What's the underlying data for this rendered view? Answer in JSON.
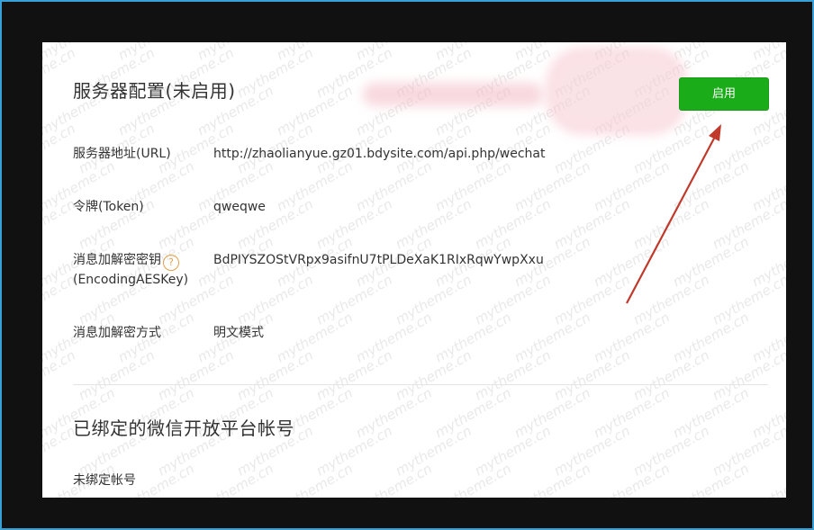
{
  "server_config": {
    "title": "服务器配置(未启用)",
    "enable_button_label": "启用",
    "rows": [
      {
        "label": "服务器地址(URL)",
        "value": "http://zhaolianyue.gz01.bdysite.com/api.php/wechat"
      },
      {
        "label": "令牌(Token)",
        "value": "qweqwe"
      },
      {
        "label_line1": "消息加解密密钥",
        "label_line2": "(EncodingAESKey)",
        "help_icon": "?",
        "value": "BdPIYSZOStVRpx9asifnU7tPLDeXaK1RIxRqwYwpXxu"
      },
      {
        "label": "消息加解密方式",
        "value": "明文模式"
      }
    ]
  },
  "open_platform": {
    "title": "已绑定的微信开放平台帐号",
    "status": "未绑定帐号"
  },
  "watermark_text": "mytheme.cn",
  "colors": {
    "enable_button": "#1aad19",
    "arrow": "#c0392b",
    "help_icon": "#e3a04a",
    "frame_border": "#39a0d6"
  }
}
